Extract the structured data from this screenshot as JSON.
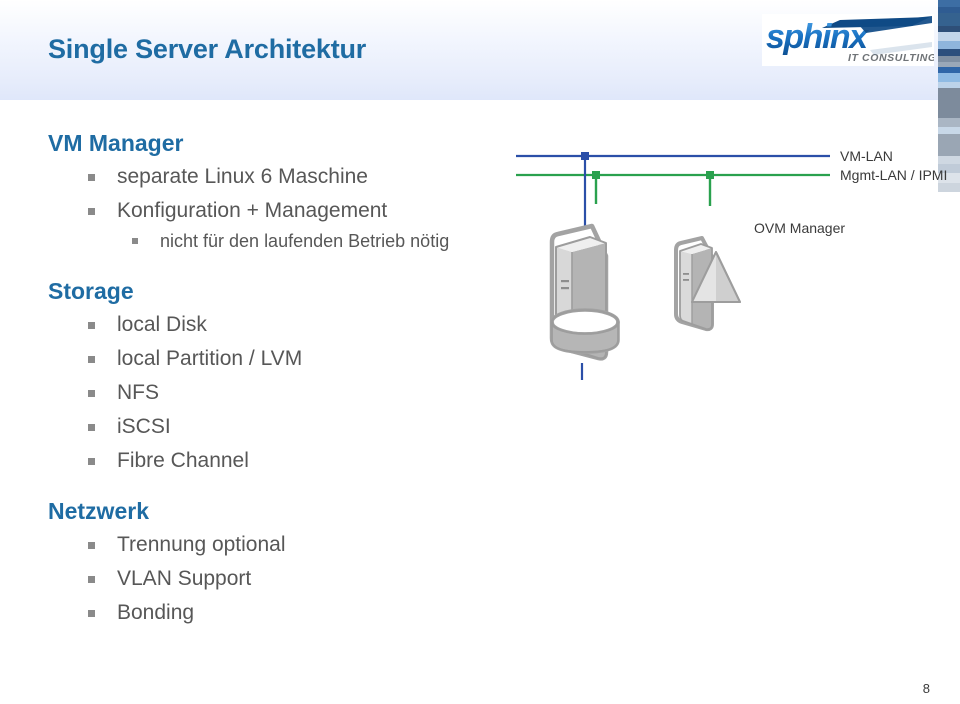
{
  "slide": {
    "title": "Single Server Architektur",
    "page_number": "8",
    "title_color": "#1f6ca3",
    "body_text_color": "#575757",
    "bullet_color": "#8a8a8a"
  },
  "logo": {
    "wordmark": "sphinx",
    "tagline": "IT CONSULTING",
    "brand_color": "#1a73c4",
    "dark_color": "#0f4a86"
  },
  "edge_bars": [
    {
      "color": "#3d6ea4",
      "height": 7
    },
    {
      "color": "#2f5c92",
      "height": 6
    },
    {
      "color": "#35628f",
      "height": 13
    },
    {
      "color": "#2e4f78",
      "height": 6
    },
    {
      "color": "#c3d6ea",
      "height": 9
    },
    {
      "color": "#8fb5dc",
      "height": 8
    },
    {
      "color": "#2c4f7d",
      "height": 7
    },
    {
      "color": "#7f8fa2",
      "height": 6
    },
    {
      "color": "#9aa8b8",
      "height": 5
    },
    {
      "color": "#2f66a8",
      "height": 6
    },
    {
      "color": "#8fbbe4",
      "height": 9
    },
    {
      "color": "#bcd3ea",
      "height": 6
    },
    {
      "color": "#7d8b9c",
      "height": 30
    },
    {
      "color": "#aab6c4",
      "height": 9
    },
    {
      "color": "#c8d8e8",
      "height": 7
    },
    {
      "color": "#9aa6b4",
      "height": 22
    },
    {
      "color": "#cfd8e2",
      "height": 8
    },
    {
      "color": "#c0cbd8",
      "height": 9
    },
    {
      "color": "#dde3ea",
      "height": 10
    },
    {
      "color": "#cdd5de",
      "height": 9
    }
  ],
  "sections": [
    {
      "heading": "VM Manager",
      "bullets": [
        {
          "level": 1,
          "text": "separate Linux 6 Maschine"
        },
        {
          "level": 1,
          "text": "Konfiguration + Management"
        },
        {
          "level": 2,
          "text": "nicht für den laufenden Betrieb nötig"
        }
      ]
    },
    {
      "heading": "Storage",
      "bullets": [
        {
          "level": 1,
          "text": "local Disk"
        },
        {
          "level": 1,
          "text": "local Partition / LVM"
        },
        {
          "level": 1,
          "text": "NFS"
        },
        {
          "level": 1,
          "text": "iSCSI"
        },
        {
          "level": 1,
          "text": "Fibre Channel"
        }
      ]
    },
    {
      "heading": "Netzwerk",
      "bullets": [
        {
          "level": 1,
          "text": "Trennung optional"
        },
        {
          "level": 1,
          "text": "VLAN Support"
        },
        {
          "level": 1,
          "text": "Bonding"
        }
      ]
    }
  ],
  "diagram": {
    "networks": [
      {
        "name": "vm-lan",
        "label": "VM-LAN",
        "color": "#2b4fa8"
      },
      {
        "name": "mgmt-lan",
        "label": "Mgmt-LAN / IPMI",
        "color": "#2aa14e"
      }
    ],
    "nodes": [
      {
        "name": "server-tower",
        "label": ""
      },
      {
        "name": "ovm-manager-server",
        "label": "OVM Manager"
      },
      {
        "name": "storage-disk",
        "label": ""
      }
    ],
    "label_color": "#3a3a3a",
    "icon_outline_color": "#9d9d9d",
    "icon_fill_light": "#f2f2f2",
    "icon_fill_mid": "#c9c9c9",
    "icon_fill_dark": "#a8a8a8"
  }
}
